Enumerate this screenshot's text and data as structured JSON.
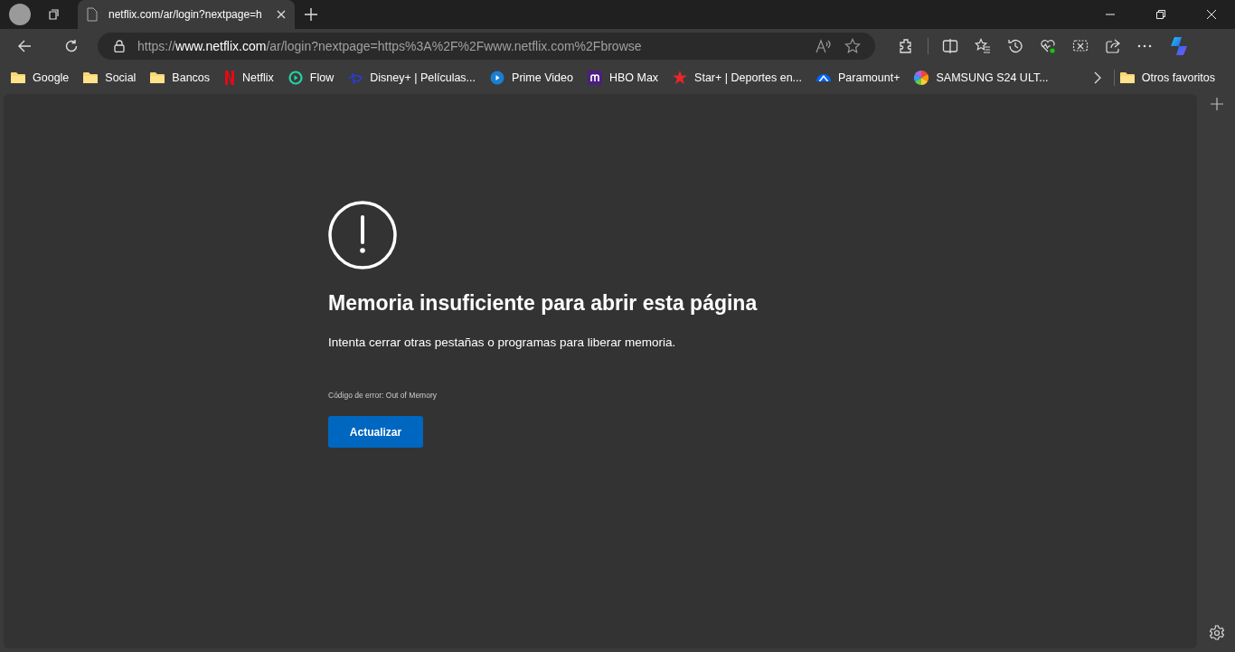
{
  "tab": {
    "title": "netflix.com/ar/login?nextpage=h",
    "selected": true
  },
  "address": {
    "scheme": "https://",
    "host": "www.netflix.com",
    "path": "/ar/login?nextpage=https%3A%2F%2Fwww.netflix.com%2Fbrowse"
  },
  "bookmarks": [
    {
      "label": "Google",
      "kind": "folder"
    },
    {
      "label": "Social",
      "kind": "folder"
    },
    {
      "label": "Bancos",
      "kind": "folder"
    },
    {
      "label": "Netflix",
      "kind": "nlogo"
    },
    {
      "label": "Flow",
      "kind": "playring"
    },
    {
      "label": "Disney+ | Películas...",
      "kind": "swoosh"
    },
    {
      "label": "Prime Video",
      "kind": "playdisc"
    },
    {
      "label": "HBO Max",
      "kind": "mlogo"
    },
    {
      "label": "Star+ | Deportes en...",
      "kind": "star"
    },
    {
      "label": "Paramount+",
      "kind": "peak"
    },
    {
      "label": "SAMSUNG S24 ULT...",
      "kind": "pinwheel"
    }
  ],
  "other_favorites": "Otros favoritos",
  "error": {
    "title": "Memoria insuficiente para abrir esta página",
    "message": "Intenta cerrar otras pestañas o programas para liberar memoria.",
    "code": "Código de error: Out of Memory",
    "button": "Actualizar"
  }
}
